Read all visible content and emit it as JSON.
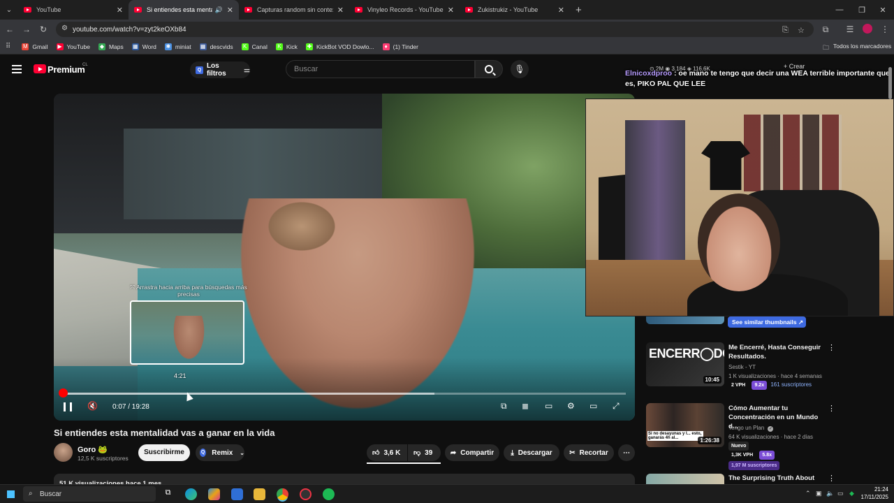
{
  "tabs": [
    {
      "title": "YouTube",
      "active": false
    },
    {
      "title": "Si entiendes esta mentalidad",
      "active": true
    },
    {
      "title": "Capturas random sin contexto",
      "active": false
    },
    {
      "title": "Vinyleo Records - YouTube",
      "active": false
    },
    {
      "title": "Zukistrukiz - YouTube",
      "active": false
    }
  ],
  "address": {
    "url": "youtube.com/watch?v=zyt2keOXb84"
  },
  "bookmarks": [
    {
      "label": "Gmail",
      "color": "#ea4335",
      "glyph": "M"
    },
    {
      "label": "YouTube",
      "color": "#ff0033",
      "glyph": "▶"
    },
    {
      "label": "Maps",
      "color": "#34a853",
      "glyph": "◆"
    },
    {
      "label": "Word",
      "color": "#2b579a",
      "glyph": "▦"
    },
    {
      "label": "miniat",
      "color": "#4a90e2",
      "glyph": "✱"
    },
    {
      "label": "descvids",
      "color": "#3b5998",
      "glyph": "▦"
    },
    {
      "label": "Canal",
      "color": "#53fc18",
      "glyph": "K"
    },
    {
      "label": "Kick",
      "color": "#53fc18",
      "glyph": "K"
    },
    {
      "label": "KickBot VOD Dowlo...",
      "color": "#53fc18",
      "glyph": "✚"
    },
    {
      "label": "(1) Tinder",
      "color": "#fe3c72",
      "glyph": "♦"
    }
  ],
  "bookmarks_all": "Todos los marcadores",
  "header": {
    "brand": "Premium",
    "country": "CL",
    "filters": "Los filtros",
    "search_placeholder": "Buscar",
    "stats": "⊙ 2M  ◉ 3.184  ◈ 116,6K",
    "crear": "+ Crear"
  },
  "chat": {
    "user": "Elnicoxdproo",
    "message": " : oe mano te tengo que decir una WEA terrible importante que es, PIKO PAL QUE LEE"
  },
  "player": {
    "swipe_hint": "⤧ Arrastra hacia arriba para búsquedas más precisas",
    "preview_time": "4:21",
    "time": "0:07 / 19:28",
    "played_fraction": 0.006,
    "buffered_fraction": 0.66
  },
  "video": {
    "title": "Si entiendes esta mentalidad vas a ganar en la vida",
    "channel": "Goro 🐸",
    "subs": "12,5 K suscriptores",
    "subscribe": "Suscribirme",
    "remix": "Remix",
    "likes": "3,6 K",
    "dislikes": "39",
    "share": "Compartir",
    "download": "Descargar",
    "clip": "Recortar",
    "desc_views": "51 K visualizaciones  hace 1 mes"
  },
  "similar_thumbnails": "See similar thumbnails ↗",
  "recommendations": [
    {
      "title": "Me Encerré, Hasta Conseguir Resultados.",
      "channel": "Sestik - YT",
      "meta": "1 K visualizaciones · hace 4 semanas",
      "duration": "10:45",
      "thumb_text": "ENCERR◯DO",
      "vph": "2 VPH",
      "mult": "9.2x",
      "subs": "161 suscriptores"
    },
    {
      "title": "Cómo Aumentar tu Concentración en un Mundo d...",
      "channel": "Tengo un Plan",
      "meta": "64 K visualizaciones · hace 2 días",
      "duration": "1:26:38",
      "thumb_text": "Si no desayunas y l... esto, ganarás 4h al...",
      "badge": "Nuevo",
      "vph": "1,3K VPH",
      "mult": "5.8x",
      "subs": "1,97 M suscriptores"
    },
    {
      "title": "The Surprising Truth About",
      "channel": "",
      "meta": "",
      "duration": ""
    }
  ],
  "taskbar": {
    "search": "Buscar",
    "time": "21:24",
    "date": "17/11/2025"
  }
}
